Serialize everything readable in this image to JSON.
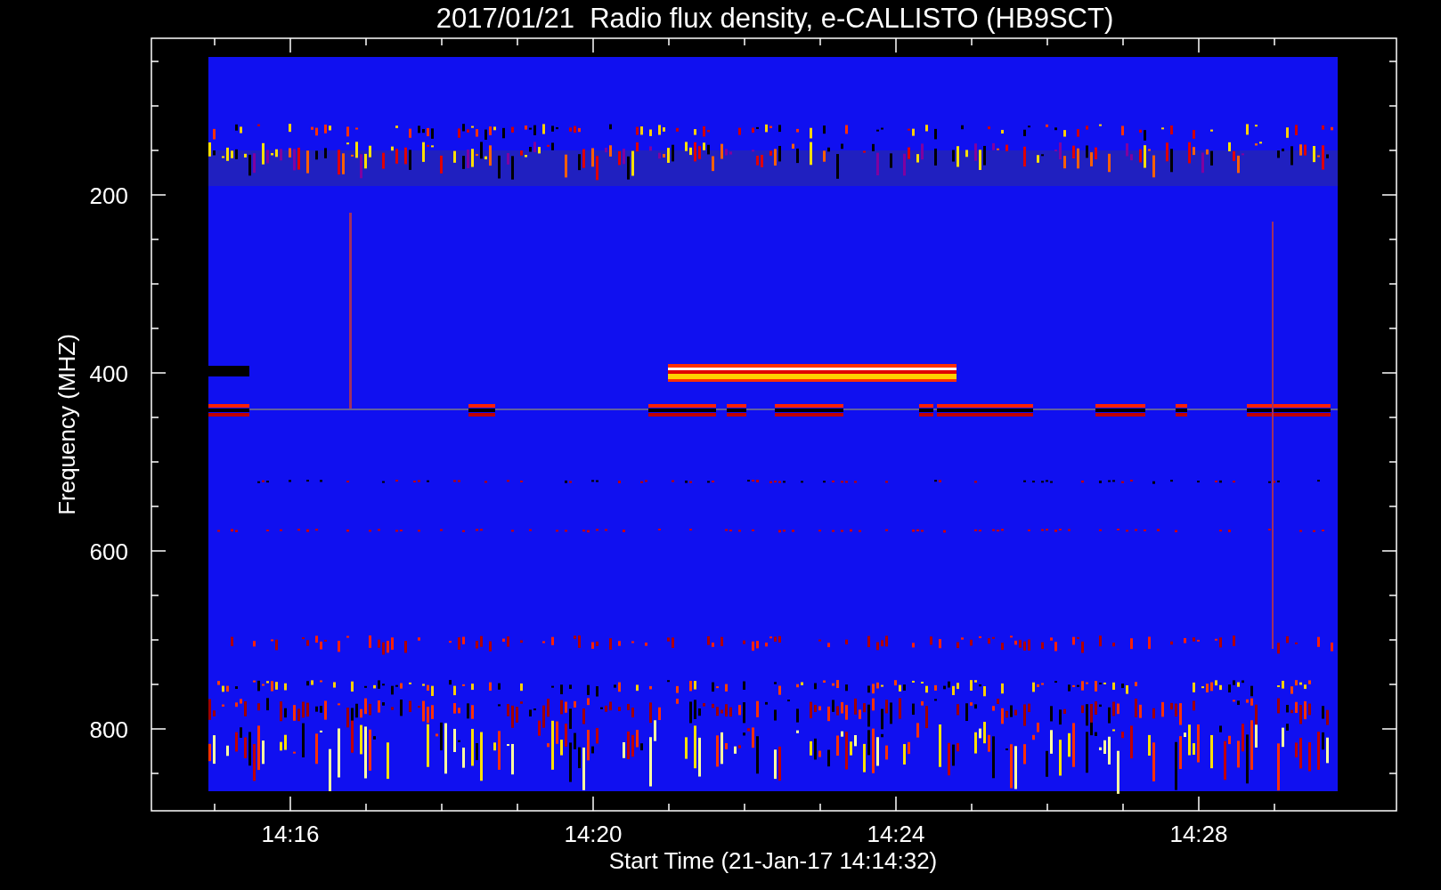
{
  "title": "2017/01/21  Radio flux density, e-CALLISTO (HB9SCT)",
  "y_axis": {
    "label": "Frequency (MHZ)",
    "ticks": [
      "200",
      "400",
      "600",
      "800"
    ]
  },
  "x_axis": {
    "label": "Start Time (21-Jan-17 14:14:32)",
    "ticks": [
      "14:16",
      "14:20",
      "14:24",
      "14:28"
    ]
  }
}
